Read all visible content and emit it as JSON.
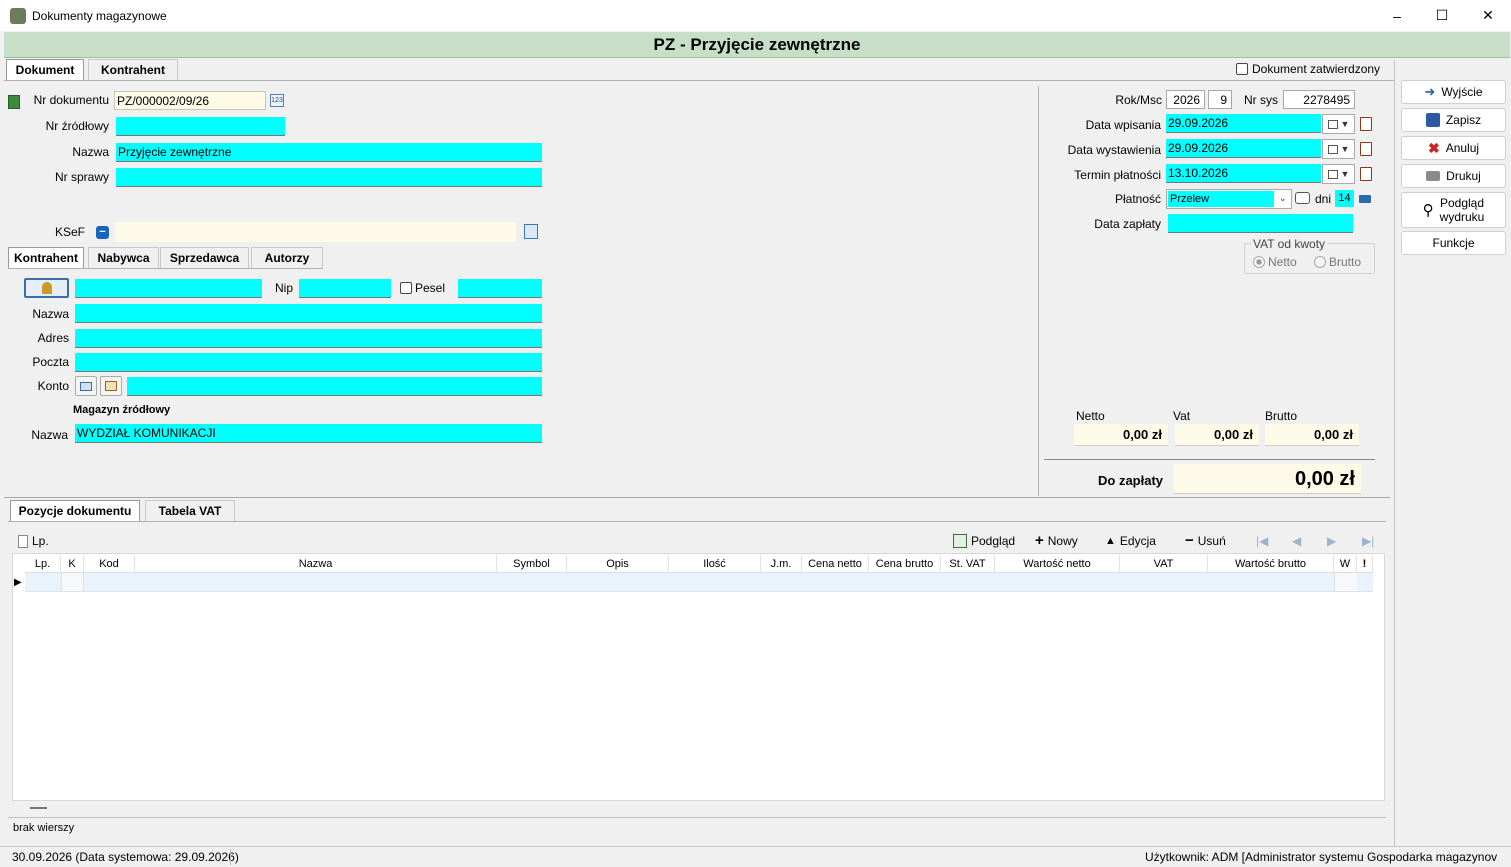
{
  "window": {
    "title": "Dokumenty magazynowe",
    "minimize": "–",
    "maximize": "☐",
    "close": "✕"
  },
  "header": {
    "title": "PZ - Przyjęcie zewnętrzne"
  },
  "top_tabs": [
    "Dokument",
    "Kontrahent"
  ],
  "approved_checkbox_label": "Dokument zatwierdzony",
  "doc": {
    "nr_dokumentu_label": "Nr dokumentu",
    "nr_dokumentu": "PZ/000002/09/26",
    "nr_zrodlowy_label": "Nr źródłowy",
    "nr_zrodlowy": "",
    "nazwa_label": "Nazwa",
    "nazwa": "Przyjęcie zewnętrzne",
    "nr_sprawy_label": "Nr sprawy",
    "nr_sprawy": "",
    "ksef_label": "KSeF",
    "ksef": ""
  },
  "party_tabs": [
    "Kontrahent",
    "Nabywca",
    "Sprzedawca",
    "Autorzy"
  ],
  "party": {
    "code": "",
    "nip_label": "Nip",
    "nip": "",
    "pesel_label": "Pesel",
    "pesel": "",
    "nazwa_label": "Nazwa",
    "nazwa": "",
    "adres_label": "Adres",
    "adres": "",
    "poczta_label": "Poczta",
    "poczta": "",
    "konto_label": "Konto",
    "konto": ""
  },
  "warehouse": {
    "section_label": "Magazyn źródłowy",
    "nazwa_label": "Nazwa",
    "nazwa": "WYDZIAŁ KOMUNIKACJI"
  },
  "right": {
    "rok_msc_label": "Rok/Msc",
    "rok": "2026",
    "msc": "9",
    "nr_sys_label": "Nr sys",
    "nr_sys": "2278495",
    "data_wpisania_label": "Data wpisania",
    "data_wpisania": "29.09.2026",
    "data_wystawienia_label": "Data wystawienia",
    "data_wystawienia": "29.09.2026",
    "termin_platnosci_label": "Termin płatności",
    "termin_platnosci": "13.10.2026",
    "platnosc_label": "Płatność",
    "platnosc": "Przelew",
    "dni_label": "dni",
    "dni": "14",
    "data_zaplaty_label": "Data zapłaty",
    "data_zaplaty": "",
    "vat_group_label": "VAT od kwoty",
    "vat_options": [
      "Netto",
      "Brutto"
    ]
  },
  "totals": {
    "netto_label": "Netto",
    "netto": "0,00 zł",
    "vat_label": "Vat",
    "vat": "0,00 zł",
    "brutto_label": "Brutto",
    "brutto": "0,00 zł",
    "do_zaplaty_label": "Do zapłaty",
    "do_zaplaty": "0,00 zł"
  },
  "side_buttons": {
    "wyjscie": "Wyjście",
    "zapisz": "Zapisz",
    "anuluj": "Anuluj",
    "drukuj": "Drukuj",
    "podglad_wydruku_1": "Podgląd",
    "podglad_wydruku_2": "wydruku",
    "funkcje": "Funkcje"
  },
  "bottom_tabs": [
    "Pozycje dokumentu",
    "Tabela VAT"
  ],
  "grid_toolbar": {
    "lp": "Lp.",
    "podglad": "Podgląd",
    "nowy": "Nowy",
    "edycja": "Edycja",
    "usun": "Usuń"
  },
  "grid_columns": [
    "Lp.",
    "K",
    "Kod",
    "Nazwa",
    "Symbol",
    "Opis",
    "Ilość",
    "J.m.",
    "Cena netto",
    "Cena brutto",
    "St. VAT",
    "Wartość netto",
    "VAT",
    "Wartość brutto",
    "W",
    "!"
  ],
  "grid_status": "brak wierszy",
  "statusbar": {
    "left": "30.09.2026 (Data systemowa: 29.09.2026)",
    "right": "Użytkownik: ADM [Administrator systemu Gospodarka magazynov"
  }
}
